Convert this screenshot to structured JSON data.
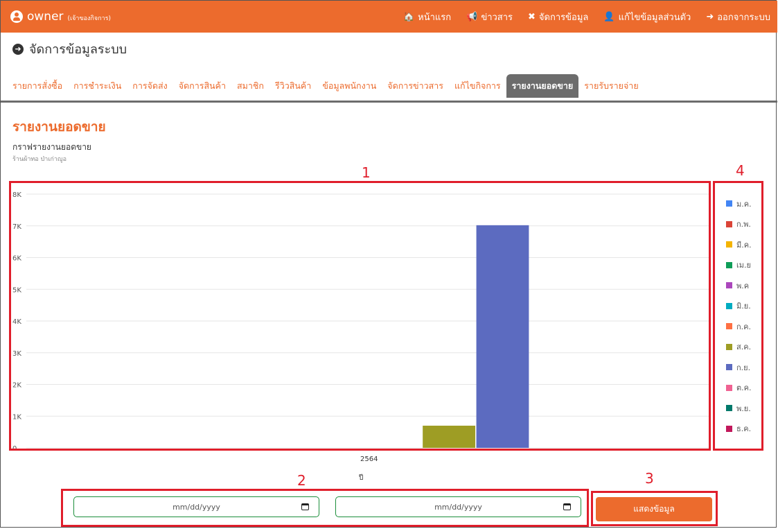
{
  "header": {
    "brand": "owner",
    "brand_sub": "(เจ้าของกิจการ)",
    "nav": [
      {
        "icon": "home-icon",
        "glyph": "🏠",
        "label": "หน้าแรก"
      },
      {
        "icon": "megaphone-icon",
        "glyph": "📢",
        "label": "ข่าวสาร"
      },
      {
        "icon": "tools-icon",
        "glyph": "✖",
        "label": "จัดการข้อมูล"
      },
      {
        "icon": "user-edit-icon",
        "glyph": "👤",
        "label": "แก้ไขข้อมูลส่วนตัว"
      },
      {
        "icon": "sign-out-icon",
        "glyph": "➜",
        "label": "ออกจากระบบ"
      }
    ]
  },
  "page": {
    "title": "จัดการข้อมูลระบบ",
    "tabs": [
      "รายการสั่งซื้อ",
      "การชำระเงิน",
      "การจัดส่ง",
      "จัดการสินค้า",
      "สมาชิก",
      "รีวิวสินค้า",
      "ข้อมูลพนักงาน",
      "จัดการข่าวสาร",
      "แก้ไขกิจการ",
      "รายงานยอดขาย",
      "รายรับรายจ่าย"
    ],
    "active_tab": 9
  },
  "report": {
    "title": "รายงานยอดขาย",
    "subtitle": "กราฟรายงานยอดขาย",
    "shop": "ร้านผ้าทอ ป่าเก่าญูอ"
  },
  "annotations": {
    "n1": "1",
    "n2": "2",
    "n3": "3",
    "n4": "4"
  },
  "filter": {
    "start_placeholder": "mm/dd/yyyy",
    "end_placeholder": "mm/dd/yyyy",
    "button_label": "แสดงข้อมูล"
  },
  "colors": {
    "brand": "#ec6b2d",
    "annotation": "#e01e2b"
  },
  "chart_data": {
    "type": "bar",
    "categories": [
      "2564"
    ],
    "xlabel": "ปี",
    "ylabel": "",
    "ylim": [
      0,
      8000
    ],
    "yticks": [
      "0",
      "1K",
      "2K",
      "3K",
      "4K",
      "5K",
      "6K",
      "7K",
      "8K"
    ],
    "grid": true,
    "legend_position": "right",
    "series": [
      {
        "name": "ม.ค.",
        "color": "#4285f4",
        "values": [
          0
        ]
      },
      {
        "name": "ก.พ.",
        "color": "#db4437",
        "values": [
          0
        ]
      },
      {
        "name": "มี.ค.",
        "color": "#f4b400",
        "values": [
          0
        ]
      },
      {
        "name": "เม.ย",
        "color": "#0f9d58",
        "values": [
          0
        ]
      },
      {
        "name": "พ.ค",
        "color": "#ab47bc",
        "values": [
          0
        ]
      },
      {
        "name": "มิ.ย.",
        "color": "#00acc1",
        "values": [
          0
        ]
      },
      {
        "name": "ก.ค.",
        "color": "#ff7043",
        "values": [
          0
        ]
      },
      {
        "name": "ส.ค.",
        "color": "#9e9d24",
        "values": [
          700
        ]
      },
      {
        "name": "ก.ย.",
        "color": "#5c6bc0",
        "values": [
          7020
        ]
      },
      {
        "name": "ต.ค.",
        "color": "#f06292",
        "values": [
          0
        ]
      },
      {
        "name": "พ.ย.",
        "color": "#00796b",
        "values": [
          0
        ]
      },
      {
        "name": "ธ.ค.",
        "color": "#c2185b",
        "values": [
          0
        ]
      }
    ]
  }
}
